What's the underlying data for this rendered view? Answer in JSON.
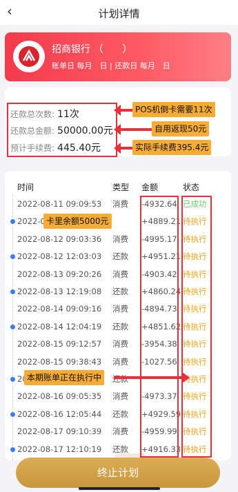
{
  "nav": {
    "back_icon": "chevron-left-icon",
    "title": "计划详情"
  },
  "bank": {
    "name": "招商银行 （　　）",
    "sub": "账单日 每月　日 | 还款日 每月　日",
    "logo_icon": "cmb-logo-icon"
  },
  "summary": {
    "rows": [
      {
        "label": "还款总次数:",
        "value": "11次"
      },
      {
        "label": "还款总金额:",
        "value": "50000.00元"
      },
      {
        "label": "预计手续费:",
        "value": "445.40元"
      }
    ]
  },
  "callouts": {
    "pos": "POS机倒卡需要11次",
    "cashback": "自用返现50元",
    "actual_fee": "实际手续费395.4元",
    "balance": "卡里余额5000元",
    "executing": "本期账单正在执行中"
  },
  "table": {
    "headers": {
      "time": "时间",
      "type": "类型",
      "amount": "金额",
      "status": "状态"
    },
    "rows": [
      {
        "time": "2022-08-11 09:09:53",
        "type": "消费",
        "amount": "-4932.64",
        "status": "已成功"
      },
      {
        "time": "2022-08-11 ...",
        "type": "",
        "amount": "+4889.21",
        "status": "待执行"
      },
      {
        "time": "2022-08-12 09:03:36",
        "type": "消费",
        "amount": "-4995.17",
        "status": "待执行"
      },
      {
        "time": "2022-08-12 12:03:03",
        "type": "还款",
        "amount": "+4951.21",
        "status": "待执行"
      },
      {
        "time": "2022-08-13 09:20:26",
        "type": "消费",
        "amount": "-4903.42",
        "status": "待执行"
      },
      {
        "time": "2022-08-13 12:19:08",
        "type": "还款",
        "amount": "+4860.24",
        "status": "待执行"
      },
      {
        "time": "2022-08-14 09:09:16",
        "type": "消费",
        "amount": "-4894.73",
        "status": "待执行"
      },
      {
        "time": "2022-08-14 12:04:19",
        "type": "还款",
        "amount": "+4851.62",
        "status": "待执行"
      },
      {
        "time": "2022-08-15 09:12:57",
        "type": "消费",
        "amount": "-3954.38",
        "status": "待执行"
      },
      {
        "time": "2022-08-15 09:38:43",
        "type": "消费",
        "amount": "-1027.56",
        "status": "待执行"
      },
      {
        "time": "2022-08-15 ...",
        "type": "还款",
        "amount": "",
        "status": "待执行"
      },
      {
        "time": "2022-08-16 09:05:35",
        "type": "消费",
        "amount": "-4973.37",
        "status": "待执行"
      },
      {
        "time": "2022-08-16 12:05:44",
        "type": "还款",
        "amount": "+4929.59",
        "status": "待执行"
      },
      {
        "time": "2022-08-17 09:10:39",
        "type": "消费",
        "amount": "-4959.99",
        "status": "待执行"
      },
      {
        "time": "2022-08-17 12:10:19",
        "type": "还款",
        "amount": "+4916.33",
        "status": "待执行"
      }
    ]
  },
  "stop_button": "终止计划",
  "colors": {
    "brand_red": "#f23b4d",
    "highlight_red": "#e8303a",
    "callout_orange": "#f8ab35",
    "pending": "#f3a21c",
    "success": "#6bd06e",
    "button_gold": "#c9963c"
  }
}
